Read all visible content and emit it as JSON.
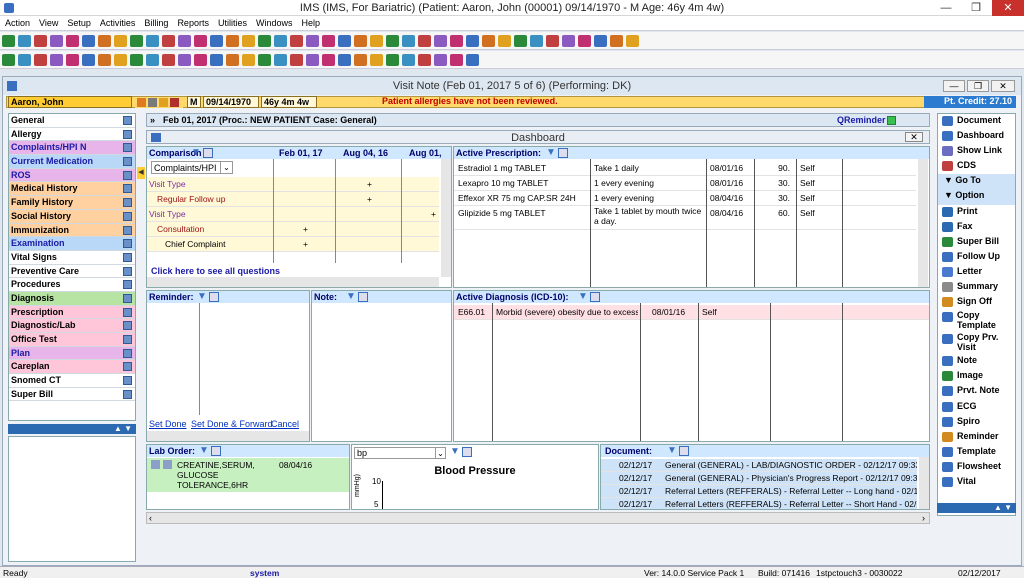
{
  "app": {
    "title": "IMS (IMS, For Bariatric)  (Patient: Aaron, John  (00001) 09/14/1970 - M Age: 46y 4m 4w)",
    "window_btns": [
      "—",
      "❐",
      "✕"
    ]
  },
  "menu": [
    "Action",
    "View",
    "Setup",
    "Activities",
    "Billing",
    "Reports",
    "Utilities",
    "Windows",
    "Help"
  ],
  "visit_window": {
    "title": "Visit Note (Feb 01, 2017   5 of 6) (Performing: DK)"
  },
  "patient": {
    "name": "Aaron, John",
    "sex": "M",
    "dob": "09/14/1970",
    "age": "46y 4m 4w",
    "alert": "Patient allergies have not been reviewed.",
    "credit": "Pt. Credit: 27.10"
  },
  "visit_bar": {
    "text": "Feb 01, 2017  (Proc.: NEW PATIENT  Case: General)",
    "qreminder": "QReminder"
  },
  "left_nav": [
    {
      "label": "General",
      "bg": "#ffffff",
      "color": "#000000"
    },
    {
      "label": "Allergy",
      "bg": "#ffffff",
      "color": "#000000"
    },
    {
      "label": "Complaints/HPI  N",
      "bg": "#e7b5ea",
      "color": "#1a1aa6"
    },
    {
      "label": "Current Medication",
      "bg": "#b9d7f7",
      "color": "#1a1aa6"
    },
    {
      "label": "ROS",
      "bg": "#e7b5ea",
      "color": "#1a1aa6"
    },
    {
      "label": "Medical History",
      "bg": "#ffd0a0",
      "color": "#000000"
    },
    {
      "label": "Family History",
      "bg": "#ffd0a0",
      "color": "#000000"
    },
    {
      "label": "Social History",
      "bg": "#ffd0a0",
      "color": "#000000"
    },
    {
      "label": "Immunization",
      "bg": "#ffd0a0",
      "color": "#000000"
    },
    {
      "label": "Examination",
      "bg": "#b9d7f7",
      "color": "#1a1aa6"
    },
    {
      "label": "Vital Signs",
      "bg": "#ffffff",
      "color": "#000000"
    },
    {
      "label": "Preventive Care",
      "bg": "#ffffff",
      "color": "#000000"
    },
    {
      "label": "Procedures",
      "bg": "#ffffff",
      "color": "#000000"
    },
    {
      "label": "Diagnosis",
      "bg": "#b7e3a3",
      "color": "#000000"
    },
    {
      "label": "Prescription",
      "bg": "#ffc6d9",
      "color": "#000000"
    },
    {
      "label": "Diagnostic/Lab",
      "bg": "#ffc6d9",
      "color": "#000000"
    },
    {
      "label": "Office Test",
      "bg": "#ffc6d9",
      "color": "#000000"
    },
    {
      "label": "Plan",
      "bg": "#e7b5ea",
      "color": "#1a1aa6"
    },
    {
      "label": "Careplan",
      "bg": "#ffc6d9",
      "color": "#000000"
    },
    {
      "label": "Snomed CT",
      "bg": "#ffffff",
      "color": "#000000"
    },
    {
      "label": "Super Bill",
      "bg": "#ffffff",
      "color": "#000000"
    }
  ],
  "dashboard": {
    "title": "Dashboard"
  },
  "comparison": {
    "header": "Comparison",
    "dates": [
      "Feb 01, 17",
      "Aug 04, 16",
      "Aug 01,"
    ],
    "dropdown": "Complaints/HPI",
    "rows": [
      {
        "label": "Visit Type",
        "c1": "",
        "c2": "+",
        "c3": "",
        "indent": 0,
        "color": "#7a2ca0"
      },
      {
        "label": "Regular Follow up",
        "c1": "",
        "c2": "+",
        "c3": "",
        "indent": 1,
        "color": "#9a1010"
      },
      {
        "label": "Visit Type",
        "c1": "",
        "c2": "",
        "c3": "+",
        "indent": 0,
        "color": "#7a2ca0"
      },
      {
        "label": "Consultation",
        "c1": "+",
        "c2": "",
        "c3": "",
        "indent": 1,
        "color": "#9a1010"
      },
      {
        "label": "Chief Complaint",
        "c1": "+",
        "c2": "",
        "c3": "",
        "indent": 2,
        "color": "#000000"
      }
    ],
    "link": "Click here to see all questions"
  },
  "prescription": {
    "header": "Active Prescription:",
    "rows": [
      {
        "drug": "Estradiol 1 mg TABLET",
        "sig": "Take 1 daily",
        "date": "08/01/16",
        "qty": "90.",
        "by": "Self"
      },
      {
        "drug": "Lexapro 10 mg TABLET",
        "sig": "1 every evening",
        "date": "08/01/16",
        "qty": "30.",
        "by": "Self"
      },
      {
        "drug": "Effexor XR 75 mg CAP.SR 24H",
        "sig": "1 every evening",
        "date": "08/04/16",
        "qty": "30.",
        "by": "Self"
      },
      {
        "drug": "Glipizide 5 mg TABLET",
        "sig": "Take 1 tablet by mouth twice a day.",
        "date": "08/04/16",
        "qty": "60.",
        "by": "Self"
      }
    ]
  },
  "reminder": {
    "header": "Reminder:",
    "set_done": "Set Done",
    "set_done_fwd": "Set Done & Forward",
    "cancel": "Cancel"
  },
  "note": {
    "header": "Note:"
  },
  "diagnosis": {
    "header": "Active Diagnosis (ICD-10):",
    "rows": [
      {
        "code": "E66.01",
        "desc": "Morbid (severe) obesity due to excess ca",
        "date": "08/01/16",
        "by": "Self"
      }
    ]
  },
  "lab": {
    "header": "Lab Order:",
    "item": "CREATINE,SERUM, GLUCOSE TOLERANCE,6HR",
    "date": "08/04/16"
  },
  "bp": {
    "select": "bp",
    "title": "Blood Pressure",
    "ylabel": "mmHg)",
    "tick_top": "10",
    "tick_bottom": "5"
  },
  "document": {
    "header": "Document:",
    "rows": [
      {
        "date": "02/12/17",
        "text": "General (GENERAL)  - LAB/DIAGNOSTIC ORDER - 02/12/17 09:33 A"
      },
      {
        "date": "02/12/17",
        "text": "General (GENERAL)  - Physician's Progress Report - 02/12/17 09:33 A"
      },
      {
        "date": "02/12/17",
        "text": "Referral Letters (REFFERALS)  - Referral Letter -- Long hand - 02/12/1"
      },
      {
        "date": "02/12/17",
        "text": "Referral Letters (REFFERALS)  - Referral Letter -- Short Hand - 02/12/1"
      }
    ]
  },
  "right_nav": [
    {
      "label": "Document",
      "color": "#3a6fc0"
    },
    {
      "label": "Dashboard",
      "color": "#3a6fc0"
    },
    {
      "label": "Show Link",
      "color": "#6c6cc0"
    },
    {
      "label": "CDS",
      "color": "#c04040"
    },
    {
      "label": "▼ Go To",
      "color": "#ffffff"
    },
    {
      "label": "▼ Option",
      "color": "#ffffff"
    },
    {
      "label": "Print",
      "color": "#2b6ab0"
    },
    {
      "label": "Fax",
      "color": "#2b6ab0"
    },
    {
      "label": "Super Bill",
      "color": "#2b8a3a"
    },
    {
      "label": "Follow Up",
      "color": "#3a6fc0"
    },
    {
      "label": "Letter",
      "color": "#4a7ad0"
    },
    {
      "label": "Summary",
      "color": "#8a8a8a"
    },
    {
      "label": "Sign Off",
      "color": "#d08a20"
    },
    {
      "label": "Copy Template",
      "color": "#3a6fc0"
    },
    {
      "label": "Copy Prv. Visit",
      "color": "#3a6fc0"
    },
    {
      "label": "Note",
      "color": "#3a6fc0"
    },
    {
      "label": "Image",
      "color": "#2b8a3a"
    },
    {
      "label": "Prvt. Note",
      "color": "#3a6fc0"
    },
    {
      "label": "ECG",
      "color": "#3a6fc0"
    },
    {
      "label": "Spiro",
      "color": "#3a6fc0"
    },
    {
      "label": "Reminder",
      "color": "#d08a20"
    },
    {
      "label": "Template",
      "color": "#3a6fc0"
    },
    {
      "label": "Flowsheet",
      "color": "#3a6fc0"
    },
    {
      "label": "Vital",
      "color": "#3a6fc0"
    }
  ],
  "status": {
    "ready": "Ready",
    "user": "system",
    "ver": "Ver: 14.0.0 Service Pack 1",
    "build": "Build: 071416",
    "server": "1stpctouch3 - 0030022",
    "date": "02/12/2017"
  }
}
